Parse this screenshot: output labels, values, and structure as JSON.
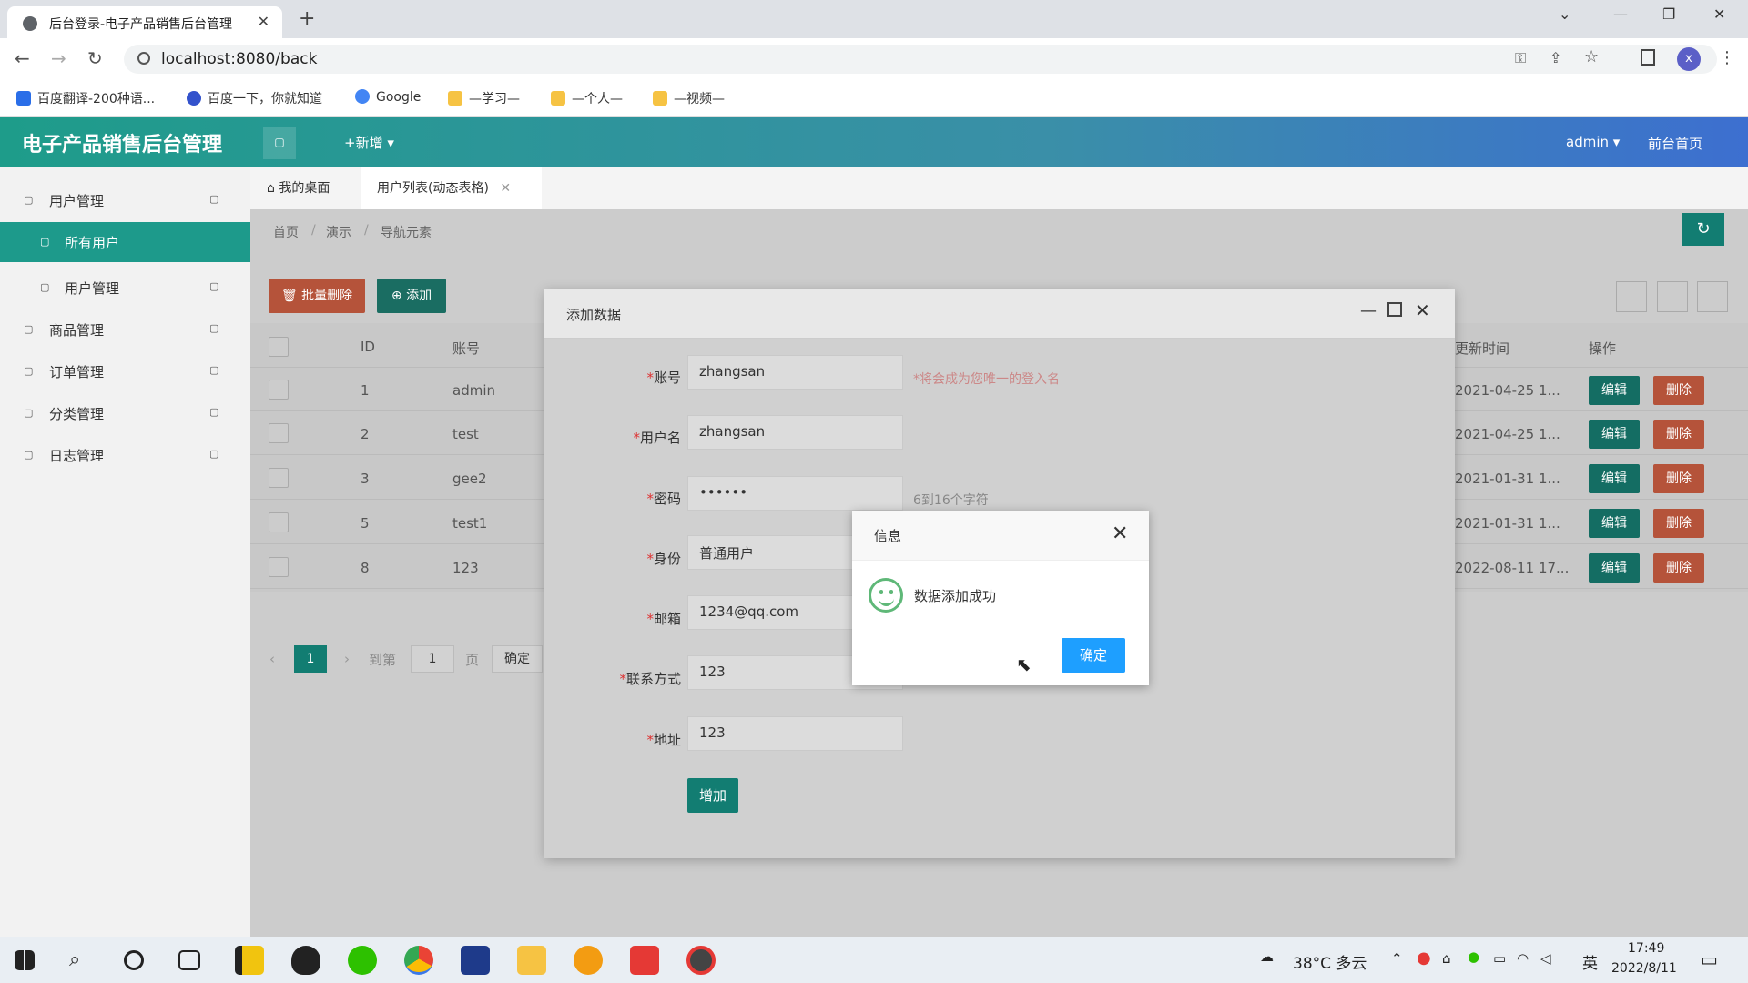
{
  "browser": {
    "tab_title": "后台登录-电子产品销售后台管理",
    "url": "localhost:8080/back",
    "bookmarks": [
      "百度翻译-200种语...",
      "百度一下，你就知道",
      "Google",
      "—学习—",
      "—个人—",
      "—视频—"
    ],
    "profile_initial": "x"
  },
  "app": {
    "title": "电子产品销售后台管理",
    "add_menu": "+新增",
    "user": "admin",
    "front_link": "前台首页"
  },
  "sidebar": {
    "items": [
      {
        "label": "用户管理"
      },
      {
        "label": "所有用户"
      },
      {
        "label": "用户管理"
      },
      {
        "label": "商品管理"
      },
      {
        "label": "订单管理"
      },
      {
        "label": "分类管理"
      },
      {
        "label": "日志管理"
      }
    ]
  },
  "page_tabs": {
    "desk": "我的桌面",
    "current": "用户列表(动态表格)"
  },
  "breadcrumb": [
    "首页",
    "演示",
    "导航元素"
  ],
  "toolbar": {
    "batch_delete": "批量删除",
    "add": "添加"
  },
  "table": {
    "headers": {
      "id": "ID",
      "account": "账号",
      "updated": "更新时间",
      "actions": "操作"
    },
    "rows": [
      {
        "id": "1",
        "account": "admin",
        "updated": "2021-04-25 1..."
      },
      {
        "id": "2",
        "account": "test",
        "updated": "2021-04-25 1..."
      },
      {
        "id": "3",
        "account": "gee2",
        "updated": "2021-01-31 1..."
      },
      {
        "id": "5",
        "account": "test1",
        "updated": "2021-01-31 1..."
      },
      {
        "id": "8",
        "account": "123",
        "updated": "2022-08-11 17..."
      }
    ],
    "edit_label": "编辑",
    "delete_label": "删除"
  },
  "pagination": {
    "current": "1",
    "goto": "到第",
    "page_input": "1",
    "page_unit": "页",
    "confirm": "确定"
  },
  "modal": {
    "title": "添加数据",
    "fields": {
      "account": {
        "label": "账号",
        "value": "zhangsan",
        "hint": "*将会成为您唯一的登入名"
      },
      "username": {
        "label": "用户名",
        "value": "zhangsan"
      },
      "password": {
        "label": "密码",
        "value": "••••••",
        "hint": "6到16个字符"
      },
      "role": {
        "label": "身份",
        "value": "普通用户"
      },
      "email": {
        "label": "邮箱",
        "value": "1234@qq.com"
      },
      "phone": {
        "label": "联系方式",
        "value": "123"
      },
      "address": {
        "label": "地址",
        "value": "123"
      }
    },
    "submit": "增加"
  },
  "dialog": {
    "title": "信息",
    "message": "数据添加成功",
    "ok": "确定"
  },
  "taskbar": {
    "weather": "38°C 多云",
    "ime": "英",
    "time": "17:49",
    "date": "2022/8/11"
  },
  "colors": {
    "primary": "#1d9a8b",
    "danger": "#e0522f",
    "info": "#1e9fff",
    "edit": "#127d72"
  }
}
